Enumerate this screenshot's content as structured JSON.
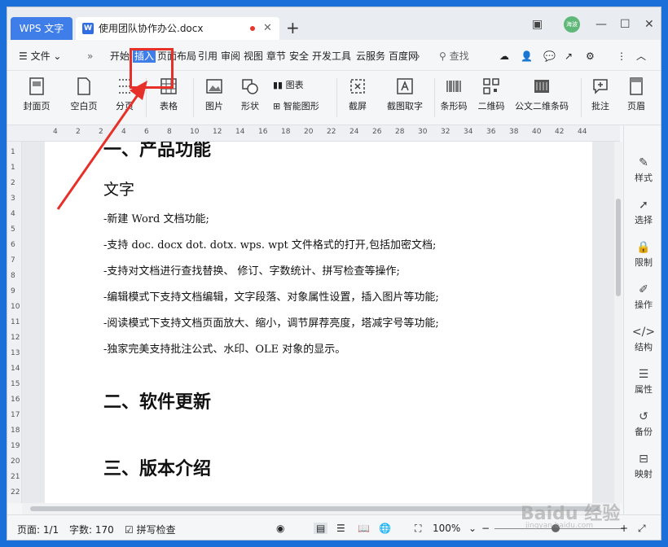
{
  "titlebar": {
    "app_tab": "WPS 文字",
    "doc_tab": "使用团队协作办公.docx",
    "new_tab_icon": "plus-icon",
    "avatar_text": "海波"
  },
  "menu": {
    "file_label": "文件",
    "items": [
      "开始",
      "插入",
      "页面布局",
      "引用",
      "审阅",
      "视图",
      "章节",
      "安全",
      "开发工具",
      "云服务",
      "百度网"
    ],
    "active": "插入",
    "search_placeholder": "查找"
  },
  "ribbon": {
    "buttons": [
      "封面页",
      "空白页",
      "分页",
      "表格",
      "图片",
      "形状",
      "截屏",
      "截图取字",
      "条形码",
      "二维码",
      "公文二维条码",
      "批注",
      "页眉"
    ],
    "small": [
      "图表",
      "智能图形"
    ]
  },
  "ruler": {
    "ticks": [
      "4",
      "2",
      "2",
      "4",
      "6",
      "8",
      "10",
      "12",
      "14",
      "16",
      "18",
      "20",
      "22",
      "24",
      "26",
      "28",
      "30",
      "32",
      "34",
      "36",
      "38",
      "40",
      "42",
      "44"
    ],
    "vticks": [
      "1",
      "1",
      "2",
      "3",
      "4",
      "5",
      "6",
      "7",
      "8",
      "9",
      "10",
      "11",
      "12",
      "13",
      "14",
      "15",
      "16",
      "17",
      "18",
      "19",
      "20",
      "21",
      "22"
    ]
  },
  "document": {
    "heading_top": "一、产品功能",
    "sub_heading": "文字",
    "paragraphs": [
      "-新建 Word 文档功能;",
      "-支持 doc. docx dot. dotx. wps. wpt 文件格式的打开,包括加密文档;",
      "-支持对文档进行查找替换、 修订、字数统计、拼写检查等操作;",
      "-编辑模式下支持文档编辑，文字段落、对象属性设置，插入图片等功能;",
      "-阅读模式下支持文档页面放大、缩小，调节屏荐亮度，塔减字号等功能;",
      "-独家完美支持批注公式、水印、OLE  对象的显示。"
    ],
    "heading_2": "二、软件更新",
    "heading_3": "三、版本介绍"
  },
  "right_panel": [
    "样式",
    "选择",
    "限制",
    "操作",
    "结构",
    "属性",
    "备份",
    "映射"
  ],
  "status": {
    "page": "页面: 1/1",
    "words": "字数: 170",
    "spell": "拼写检查",
    "zoom": "100%"
  },
  "watermark": {
    "main": "Baidu 经验",
    "sub": "jingyan.baidu.com"
  },
  "colors": {
    "accent": "#3f7ee8",
    "annotation": "#e8302a"
  }
}
